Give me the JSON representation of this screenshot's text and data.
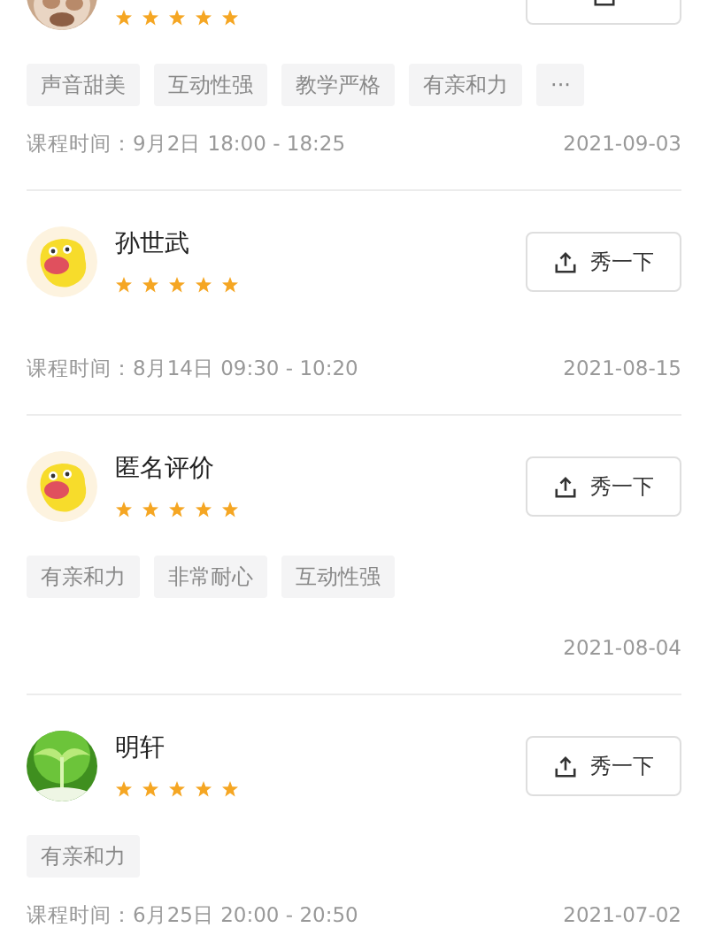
{
  "reviews": [
    {
      "stars": 5,
      "tags": [
        "声音甜美",
        "互动性强",
        "教学严格",
        "有亲和力",
        "···"
      ],
      "course_time": "课程时间：9月2日 18:00 - 18:25",
      "date": "2021-09-03"
    },
    {
      "name": "孙世武",
      "avatar": {
        "kind": "mascot"
      },
      "stars": 5,
      "share_button": {
        "label": "秀一下"
      },
      "course_time": "课程时间：8月14日 09:30 - 10:20",
      "date": "2021-08-15"
    },
    {
      "name": "匿名评价",
      "avatar": {
        "kind": "mascot"
      },
      "stars": 5,
      "share_button": {
        "label": "秀一下"
      },
      "tags": [
        "有亲和力",
        "非常耐心",
        "互动性强"
      ],
      "date": "2021-08-04"
    },
    {
      "name": "明轩",
      "avatar": {
        "kind": "plant"
      },
      "stars": 5,
      "share_button": {
        "label": "秀一下"
      },
      "tags": [
        "有亲和力"
      ],
      "course_time": "课程时间：6月25日 20:00 - 20:50",
      "date": "2021-07-02"
    }
  ]
}
